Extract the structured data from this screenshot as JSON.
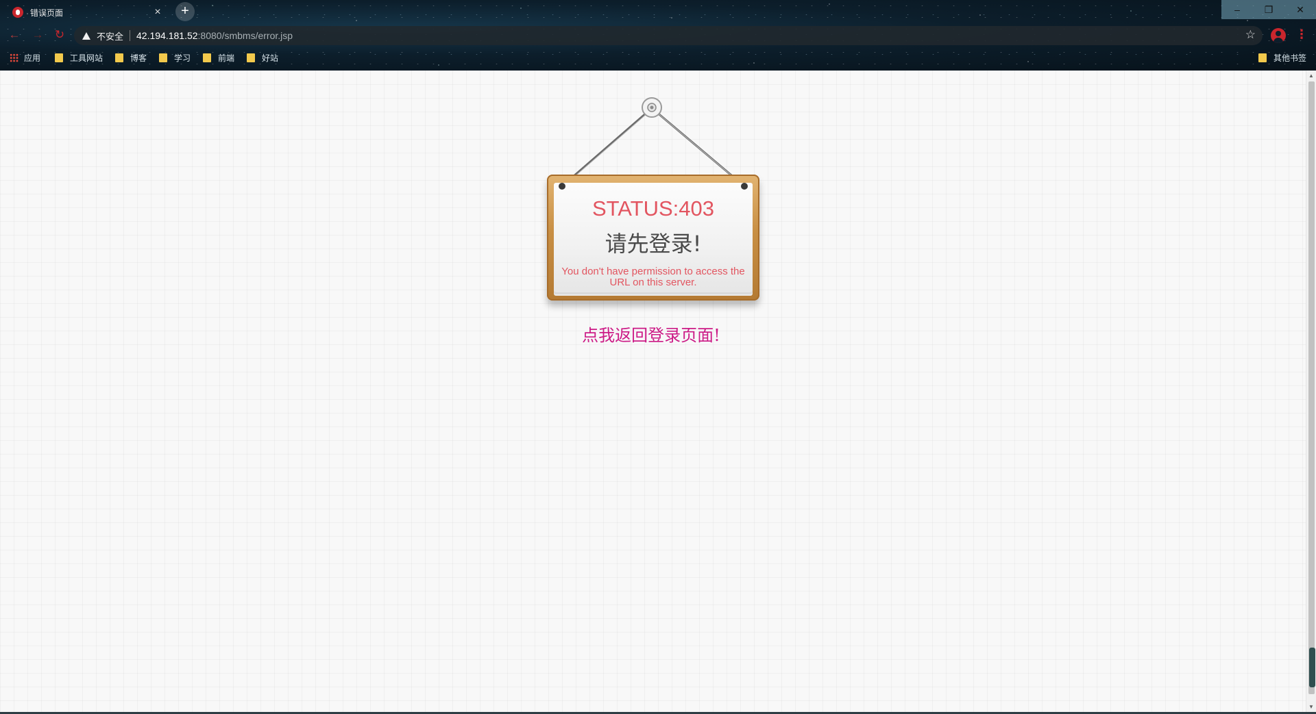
{
  "browser": {
    "tab": {
      "title": "错误页面",
      "close": "×"
    },
    "new_tab": "+",
    "window_buttons": {
      "minimize": "–",
      "maximize": "❐",
      "close": "✕"
    },
    "nav": {
      "back": "←",
      "forward": "→",
      "reload": "↻"
    },
    "address": {
      "security_label": "不安全",
      "url_host": "42.194.181.52",
      "url_path": ":8080/smbms/error.jsp"
    },
    "star": "☆",
    "menu": "⋮",
    "bookmarks": [
      {
        "label": "应用",
        "icon": "apps-icon"
      },
      {
        "label": "工具网站",
        "icon": "folder-icon"
      },
      {
        "label": "博客",
        "icon": "folder-icon"
      },
      {
        "label": "学习",
        "icon": "folder-icon"
      },
      {
        "label": "前端",
        "icon": "folder-icon"
      },
      {
        "label": "好站",
        "icon": "folder-icon"
      }
    ],
    "other_bookmarks": "其他书签"
  },
  "sign": {
    "status": "STATUS:403",
    "message_cn": "请先登录!",
    "message_en": "You don't have permission to access the URL on this server."
  },
  "back_link": "点我返回登录页面!",
  "colors": {
    "status_red": "#e25560",
    "link_magenta": "#cc1a86",
    "accent_red": "#c9262d"
  }
}
